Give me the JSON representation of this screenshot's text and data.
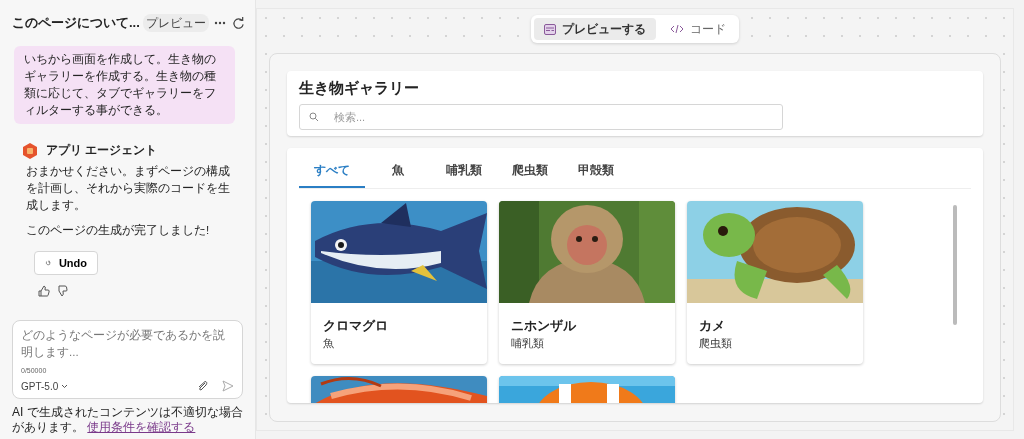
{
  "sidebar": {
    "title": "このページについて...",
    "preview_label": "プレビュー",
    "user_message": "いちから画面を作成して。生き物のギャラリーを作成する。生き物の種類に応じて、タブでギャラリーをフィルターする事ができる。",
    "agent": {
      "name": "アプリ エージェント",
      "messages": [
        "おまかせください。まずページの構成を計画し、それから実際のコードを生成します。",
        "このページの生成が完了しました!"
      ]
    },
    "undo_button": "Undo",
    "composer": {
      "placeholder": "どのようなページが必要であるかを説明します...",
      "counter": "0/50000",
      "model": "GPT-5.0"
    },
    "disclaimer": "AI で生成されたコンテンツは不適切な場合があります。",
    "terms_link": "使用条件を確認する"
  },
  "view_toggle": [
    {
      "label": "プレビューする",
      "selected": true
    },
    {
      "label": "コード",
      "selected": false
    }
  ],
  "gallery": {
    "title": "生き物ギャラリー",
    "search": {
      "placeholder": "検索..."
    },
    "tabs": [
      {
        "label": "すべて",
        "selected": true
      },
      {
        "label": "魚",
        "selected": false
      },
      {
        "label": "哺乳類",
        "selected": false
      },
      {
        "label": "爬虫類",
        "selected": false
      },
      {
        "label": "甲殻類",
        "selected": false
      }
    ],
    "cards": [
      {
        "kind": "captioned",
        "name": "クロマグロ",
        "category": "魚"
      },
      {
        "kind": "captioned",
        "name": "ニホンザル",
        "category": "哺乳類"
      },
      {
        "kind": "captioned",
        "name": "カメ",
        "category": "爬虫類"
      },
      {
        "kind": "picture"
      },
      {
        "kind": "picture"
      }
    ]
  }
}
